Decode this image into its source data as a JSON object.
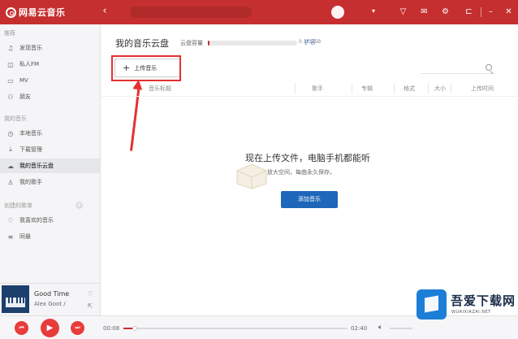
{
  "app": {
    "name": "网易云音乐"
  },
  "topbar": {
    "back_icon": "chevron-left-icon",
    "icons": [
      "tshirt-icon",
      "mail-icon",
      "gear-icon",
      "minimize-icon",
      "maximize-icon",
      "close-icon"
    ]
  },
  "sidebar": {
    "sections": [
      {
        "heading": "推荐",
        "items": [
          {
            "label": "发现音乐",
            "icon": "music-note-icon"
          },
          {
            "label": "私人FM",
            "icon": "radio-icon"
          },
          {
            "label": "MV",
            "icon": "mv-icon"
          },
          {
            "label": "朋友",
            "icon": "friends-icon"
          }
        ]
      },
      {
        "heading": "我的音乐",
        "items": [
          {
            "label": "本地音乐",
            "icon": "clock-icon"
          },
          {
            "label": "下载管理",
            "icon": "download-icon"
          },
          {
            "label": "我的音乐云盘",
            "icon": "cloud-icon",
            "active": true
          },
          {
            "label": "我的歌手",
            "icon": "singer-icon"
          }
        ]
      },
      {
        "heading": "创建的歌单",
        "items": [
          {
            "label": "我喜欢的音乐",
            "icon": "heart-icon"
          },
          {
            "label": "同悬",
            "icon": "playlist-icon"
          }
        ]
      }
    ]
  },
  "main": {
    "title": "我的音乐云盘",
    "capacity_label": "云盘容量",
    "capacity_value": "0.1K/25B",
    "capacity_fraction": 0.02,
    "expand_label": "扩容",
    "upload_button": "上传音乐",
    "columns": [
      "音乐标题",
      "歌手",
      "专辑",
      "格式",
      "大小",
      "上传时间"
    ],
    "empty_title": "现在上传文件，电脑手机都能听",
    "empty_subtitle": "放大空间，每曲永久保存。",
    "add_button": "添加音乐"
  },
  "now_playing": {
    "title": "Good Time",
    "artist": "Alex Goot /"
  },
  "player": {
    "elapsed": "00:08",
    "total": "02:40",
    "progress_fraction": 0.05
  },
  "watermark": {
    "title": "吾爱下载网",
    "subtitle": "WUAIXIAZAI.NET"
  },
  "colors": {
    "brand_red": "#c62f2f",
    "accent_blue": "#1d66b9",
    "annotation_red": "#e53030"
  }
}
